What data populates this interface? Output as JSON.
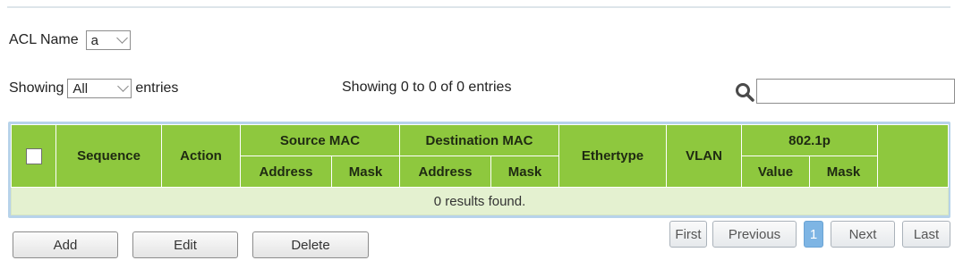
{
  "acl": {
    "label": "ACL Name",
    "selected": "a"
  },
  "entries": {
    "label_before": "Showing",
    "selected": "All",
    "label_after": "entries"
  },
  "info_text": "Showing 0 to 0 of 0 entries",
  "search": {
    "value": "",
    "placeholder": ""
  },
  "table": {
    "headers": {
      "sequence": "Sequence",
      "action": "Action",
      "source_mac": "Source MAC",
      "destination_mac": "Destination MAC",
      "ethertype": "Ethertype",
      "vlan": "VLAN",
      "dot1p": "802.1p",
      "src_address": "Address",
      "src_mask": "Mask",
      "dst_address": "Address",
      "dst_mask": "Mask",
      "dot1p_value": "Value",
      "dot1p_mask": "Mask"
    },
    "empty_message": "0 results found."
  },
  "pagination": {
    "first": "First",
    "previous": "Previous",
    "current": "1",
    "next": "Next",
    "last": "Last"
  },
  "actions": {
    "add": "Add",
    "edit": "Edit",
    "delete": "Delete"
  },
  "colors": {
    "header_green": "#8ec83e",
    "empty_row": "#e4f1d0",
    "active_page": "#7eb5e4",
    "table_border": "#b7d3ea"
  }
}
